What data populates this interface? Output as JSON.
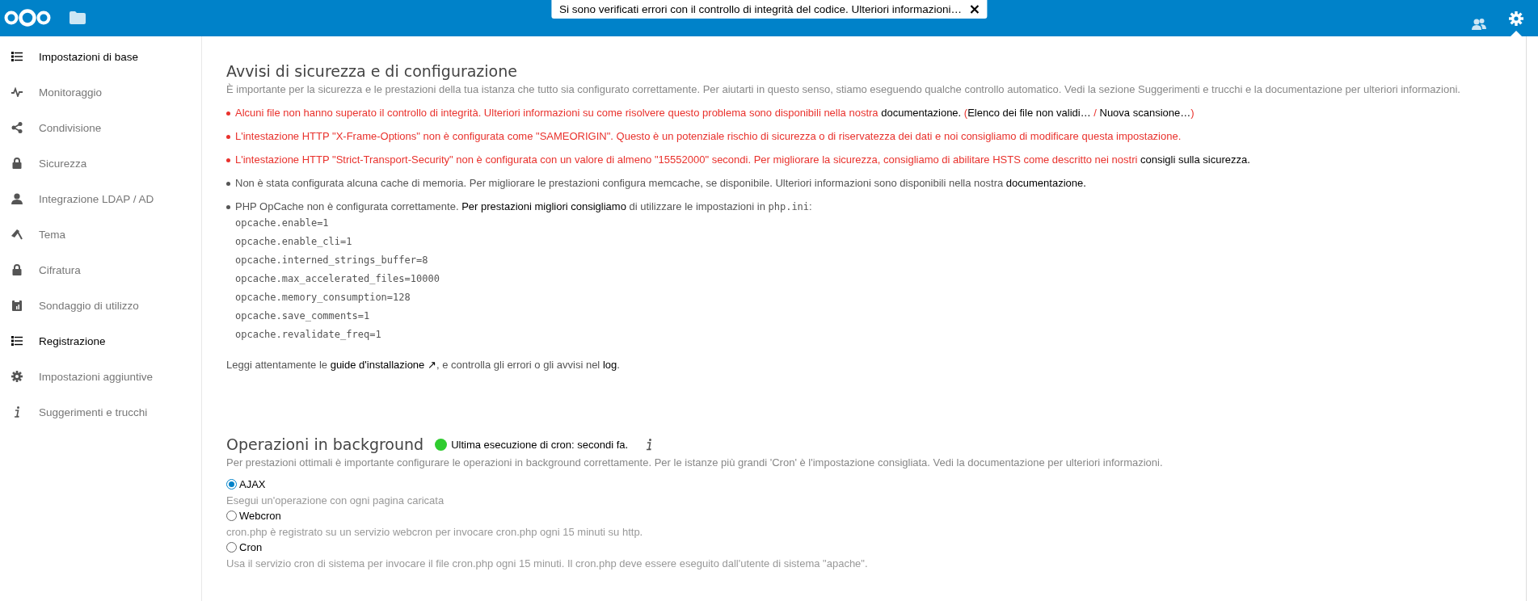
{
  "notification": {
    "text": "Si sono verificati errori con il controllo di integrità del codice. Ulteriori informazioni…"
  },
  "sidebar": {
    "items": [
      {
        "label": "Impostazioni di base",
        "selected": true
      },
      {
        "label": "Monitoraggio",
        "selected": false
      },
      {
        "label": "Condivisione",
        "selected": false
      },
      {
        "label": "Sicurezza",
        "selected": false
      },
      {
        "label": "Integrazione LDAP / AD",
        "selected": false
      },
      {
        "label": "Tema",
        "selected": false
      },
      {
        "label": "Cifratura",
        "selected": false
      },
      {
        "label": "Sondaggio di utilizzo",
        "selected": false
      },
      {
        "label": "Registrazione",
        "selected": true
      },
      {
        "label": "Impostazioni aggiuntive",
        "selected": false
      },
      {
        "label": "Suggerimenti e trucchi",
        "selected": false
      }
    ]
  },
  "security": {
    "title": "Avvisi di sicurezza e di configurazione",
    "intro": "È importante per la sicurezza e le prestazioni della tua istanza che tutto sia configurato correttamente. Per aiutarti in questo senso, stiamo eseguendo qualche controllo automatico. Vedi la sezione Suggerimenti e trucchi e la documentazione per ulteriori informazioni.",
    "warnings": [
      {
        "kind": "error",
        "parts": [
          {
            "kind": "text",
            "text": "Alcuni file non hanno superato il controllo di integrità. Ulteriori informazioni su come risolvere questo problema sono disponibili nella nostra "
          },
          {
            "kind": "link",
            "text": "documentazione."
          },
          {
            "kind": "text",
            "text": " ("
          },
          {
            "kind": "link",
            "text": "Elenco dei file non validi…"
          },
          {
            "kind": "text",
            "text": " / "
          },
          {
            "kind": "link",
            "text": "Nuova scansione…"
          },
          {
            "kind": "text",
            "text": ")"
          }
        ]
      },
      {
        "kind": "error",
        "parts": [
          {
            "kind": "text",
            "text": "L'intestazione HTTP \"X-Frame-Options\" non è configurata come \"SAMEORIGIN\". Questo è un potenziale rischio di sicurezza o di riservatezza dei dati e noi consigliamo di modificare questa impostazione."
          }
        ]
      },
      {
        "kind": "error",
        "parts": [
          {
            "kind": "text",
            "text": "L'intestazione HTTP \"Strict-Transport-Security\" non è configurata con un valore di almeno \"15552000\" secondi. Per migliorare la sicurezza, consigliamo di abilitare HSTS come descritto nei nostri "
          },
          {
            "kind": "link",
            "text": "consigli sulla sicurezza."
          }
        ]
      },
      {
        "kind": "info",
        "parts": [
          {
            "kind": "text",
            "text": "Non è stata configurata alcuna cache di memoria. Per migliorare le prestazioni configura memcache, se disponibile. Ulteriori informazioni sono disponibili nella nostra "
          },
          {
            "kind": "link",
            "text": "documentazione."
          }
        ]
      },
      {
        "kind": "info",
        "parts": [
          {
            "kind": "text",
            "text": "PHP OpCache non è configurata correttamente. "
          },
          {
            "kind": "link",
            "text": "Per prestazioni migliori consigliamo"
          },
          {
            "kind": "text",
            "text": " di utilizzare le impostazioni in "
          },
          {
            "kind": "code",
            "text": "php.ini"
          },
          {
            "kind": "text",
            "text": ":"
          }
        ],
        "code_lines": [
          "opcache.enable=1",
          "opcache.enable_cli=1",
          "opcache.interned_strings_buffer=8",
          "opcache.max_accelerated_files=10000",
          "opcache.memory_consumption=128",
          "opcache.save_comments=1",
          "opcache.revalidate_freq=1"
        ]
      }
    ],
    "footer": [
      {
        "kind": "text",
        "text": "Leggi attentamente le "
      },
      {
        "kind": "link",
        "text": "guide d'installazione ↗"
      },
      {
        "kind": "text",
        "text": ", e controlla gli errori o gli avvisi nel "
      },
      {
        "kind": "link",
        "text": "log"
      },
      {
        "kind": "text",
        "text": "."
      }
    ]
  },
  "background": {
    "title": "Operazioni in background",
    "status": {
      "text": "Ultima esecuzione di cron: secondi fa.",
      "color": "#2fcc2f"
    },
    "intro": "Per prestazioni ottimali è importante configurare le operazioni in background correttamente. Per le istanze più grandi 'Cron' è l'impostazione consigliata. Vedi la documentazione per ulteriori informazioni.",
    "options": [
      {
        "label": "AJAX",
        "selected": true,
        "description": "Esegui un'operazione con ogni pagina caricata"
      },
      {
        "label": "Webcron",
        "selected": false,
        "description": "cron.php è registrato su un servizio webcron per invocare cron.php ogni 15 minuti su http."
      },
      {
        "label": "Cron",
        "selected": false,
        "description": "Usa il servizio cron di sistema per invocare il file cron.php ogni 15 minuti. Il cron.php deve essere eseguito dall'utente di sistema \"apache\"."
      }
    ]
  }
}
